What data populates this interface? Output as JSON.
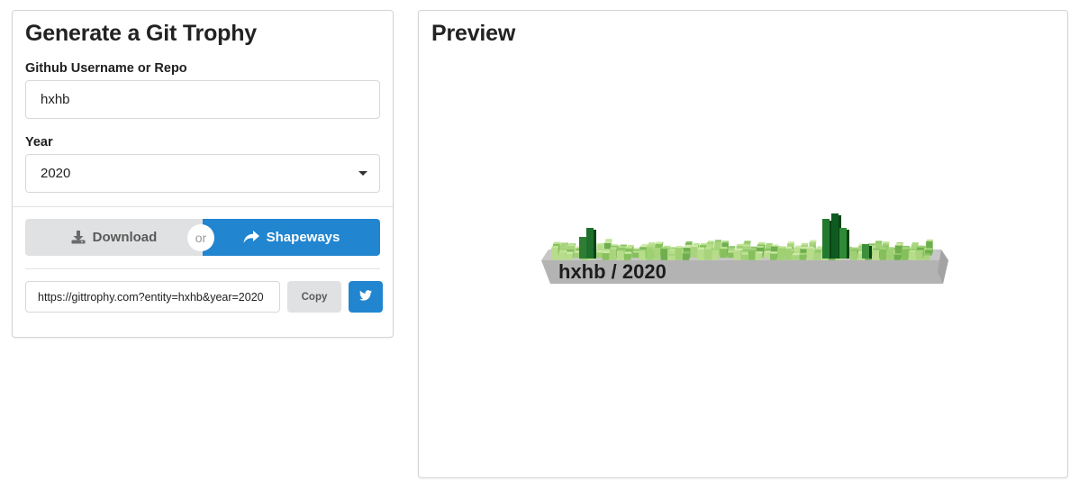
{
  "form": {
    "title": "Generate a Git Trophy",
    "username_label": "Github Username or Repo",
    "username_value": "hxhb",
    "year_label": "Year",
    "year_value": "2020"
  },
  "actions": {
    "download_label": "Download",
    "or_label": "or",
    "shapeways_label": "Shapeways",
    "download_icon": "download-icon",
    "shapeways_icon": "share-arrow-icon"
  },
  "share": {
    "url": "https://gittrophy.com?entity=hxhb&year=2020",
    "copy_label": "Copy",
    "twitter_icon": "twitter-icon"
  },
  "preview": {
    "title": "Preview",
    "trophy_text": "hxhb / 2020"
  },
  "colors": {
    "primary": "#2185d0",
    "secondary": "#e0e1e2",
    "trophy_base": "#b3b3b3",
    "contribution_green_light": "#9fd072",
    "contribution_green_dark": "#1e6f2c"
  }
}
